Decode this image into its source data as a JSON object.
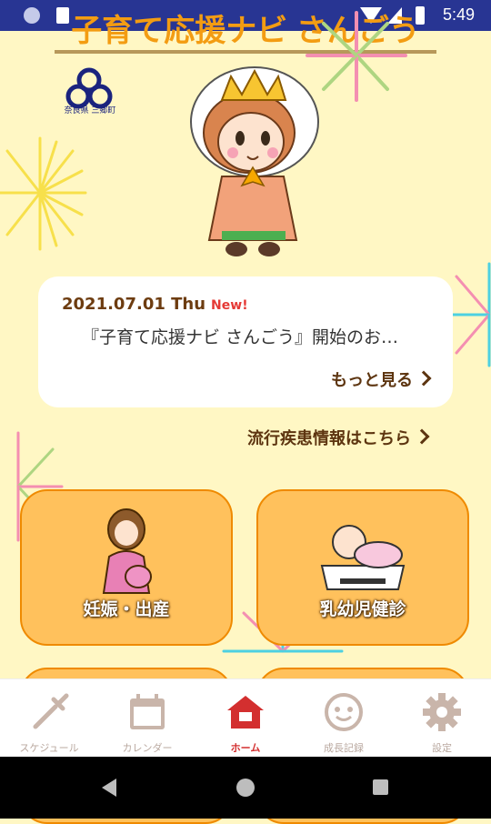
{
  "status_bar": {
    "time": "5:49"
  },
  "app": {
    "title": "子育て応援ナビ さんごう"
  },
  "logo": {
    "caption": "奈良県 三郷町"
  },
  "news": {
    "date": "2021.07.01 Thu",
    "badge": "New!",
    "title": "『子育て応援ナビ さんごう』開始のお…",
    "more_label": "もっと見る"
  },
  "links": {
    "disease_info": "流行疾患情報はこちら"
  },
  "tiles": [
    {
      "label": "妊娠・出産",
      "icon": "pregnant-woman-icon"
    },
    {
      "label": "乳幼児健診",
      "icon": "baby-on-scale-icon"
    }
  ],
  "bottom_nav": [
    {
      "label": "スケジュール",
      "icon": "syringe-icon"
    },
    {
      "label": "カレンダー",
      "icon": "calendar-icon"
    },
    {
      "label": "ホーム",
      "icon": "house-icon",
      "active": true
    },
    {
      "label": "成長記録",
      "icon": "smiley-face-icon"
    },
    {
      "label": "設定",
      "icon": "gear-icon"
    }
  ],
  "colors": {
    "background": "#fff7c4",
    "tile": "#ffc15c",
    "tile_border": "#ef8a00",
    "active_nav": "#d32f2f",
    "status_bar": "#283593"
  }
}
